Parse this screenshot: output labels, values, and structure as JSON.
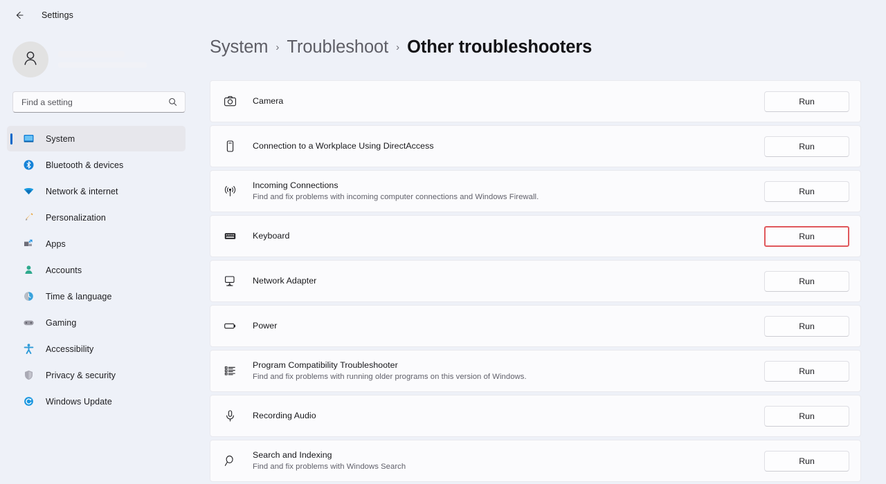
{
  "window": {
    "title": "Settings",
    "back_icon": "back-arrow-icon"
  },
  "account": {
    "avatar_icon": "person-avatar-icon"
  },
  "search": {
    "placeholder": "Find a setting",
    "value": "",
    "icon": "search-icon"
  },
  "sidebar": {
    "items": [
      {
        "label": "System",
        "icon": "monitor-icon",
        "selected": true
      },
      {
        "label": "Bluetooth & devices",
        "icon": "bluetooth-icon",
        "selected": false
      },
      {
        "label": "Network & internet",
        "icon": "wifi-icon",
        "selected": false
      },
      {
        "label": "Personalization",
        "icon": "paintbrush-icon",
        "selected": false
      },
      {
        "label": "Apps",
        "icon": "apps-grid-icon",
        "selected": false
      },
      {
        "label": "Accounts",
        "icon": "person-icon",
        "selected": false
      },
      {
        "label": "Time & language",
        "icon": "clock-globe-icon",
        "selected": false
      },
      {
        "label": "Gaming",
        "icon": "gamepad-icon",
        "selected": false
      },
      {
        "label": "Accessibility",
        "icon": "accessibility-icon",
        "selected": false
      },
      {
        "label": "Privacy & security",
        "icon": "shield-icon",
        "selected": false
      },
      {
        "label": "Windows Update",
        "icon": "update-sync-icon",
        "selected": false
      }
    ]
  },
  "breadcrumb": {
    "items": [
      "System",
      "Troubleshoot",
      "Other troubleshooters"
    ],
    "separator": "›",
    "current_index": 2
  },
  "colors": {
    "page_background": "#eef1f8",
    "card_background": "#fbfbfd",
    "accent": "#0068c9",
    "highlight_border": "#e0585c",
    "selected_nav_background": "#e7e7ec"
  },
  "troubleshooters": {
    "run_label": "Run",
    "rows": [
      {
        "title": "Camera",
        "description": "",
        "icon": "camera-icon",
        "run_label": "Run",
        "highlighted": false
      },
      {
        "title": "Connection to a Workplace Using DirectAccess",
        "description": "",
        "icon": "badge-card-icon",
        "run_label": "Run",
        "highlighted": false
      },
      {
        "title": "Incoming Connections",
        "description": "Find and fix problems with incoming computer connections and Windows Firewall.",
        "icon": "broadcast-antenna-icon",
        "run_label": "Run",
        "highlighted": false
      },
      {
        "title": "Keyboard",
        "description": "",
        "icon": "keyboard-icon",
        "run_label": "Run",
        "highlighted": true
      },
      {
        "title": "Network Adapter",
        "description": "",
        "icon": "network-adapter-icon",
        "run_label": "Run",
        "highlighted": false
      },
      {
        "title": "Power",
        "description": "",
        "icon": "battery-icon",
        "run_label": "Run",
        "highlighted": false
      },
      {
        "title": "Program Compatibility Troubleshooter",
        "description": "Find and fix problems with running older programs on this version of Windows.",
        "icon": "list-bullets-icon",
        "run_label": "Run",
        "highlighted": false
      },
      {
        "title": "Recording Audio",
        "description": "",
        "icon": "microphone-icon",
        "run_label": "Run",
        "highlighted": false
      },
      {
        "title": "Search and Indexing",
        "description": "Find and fix problems with Windows Search",
        "icon": "magnifier-icon",
        "run_label": "Run",
        "highlighted": false
      }
    ]
  }
}
